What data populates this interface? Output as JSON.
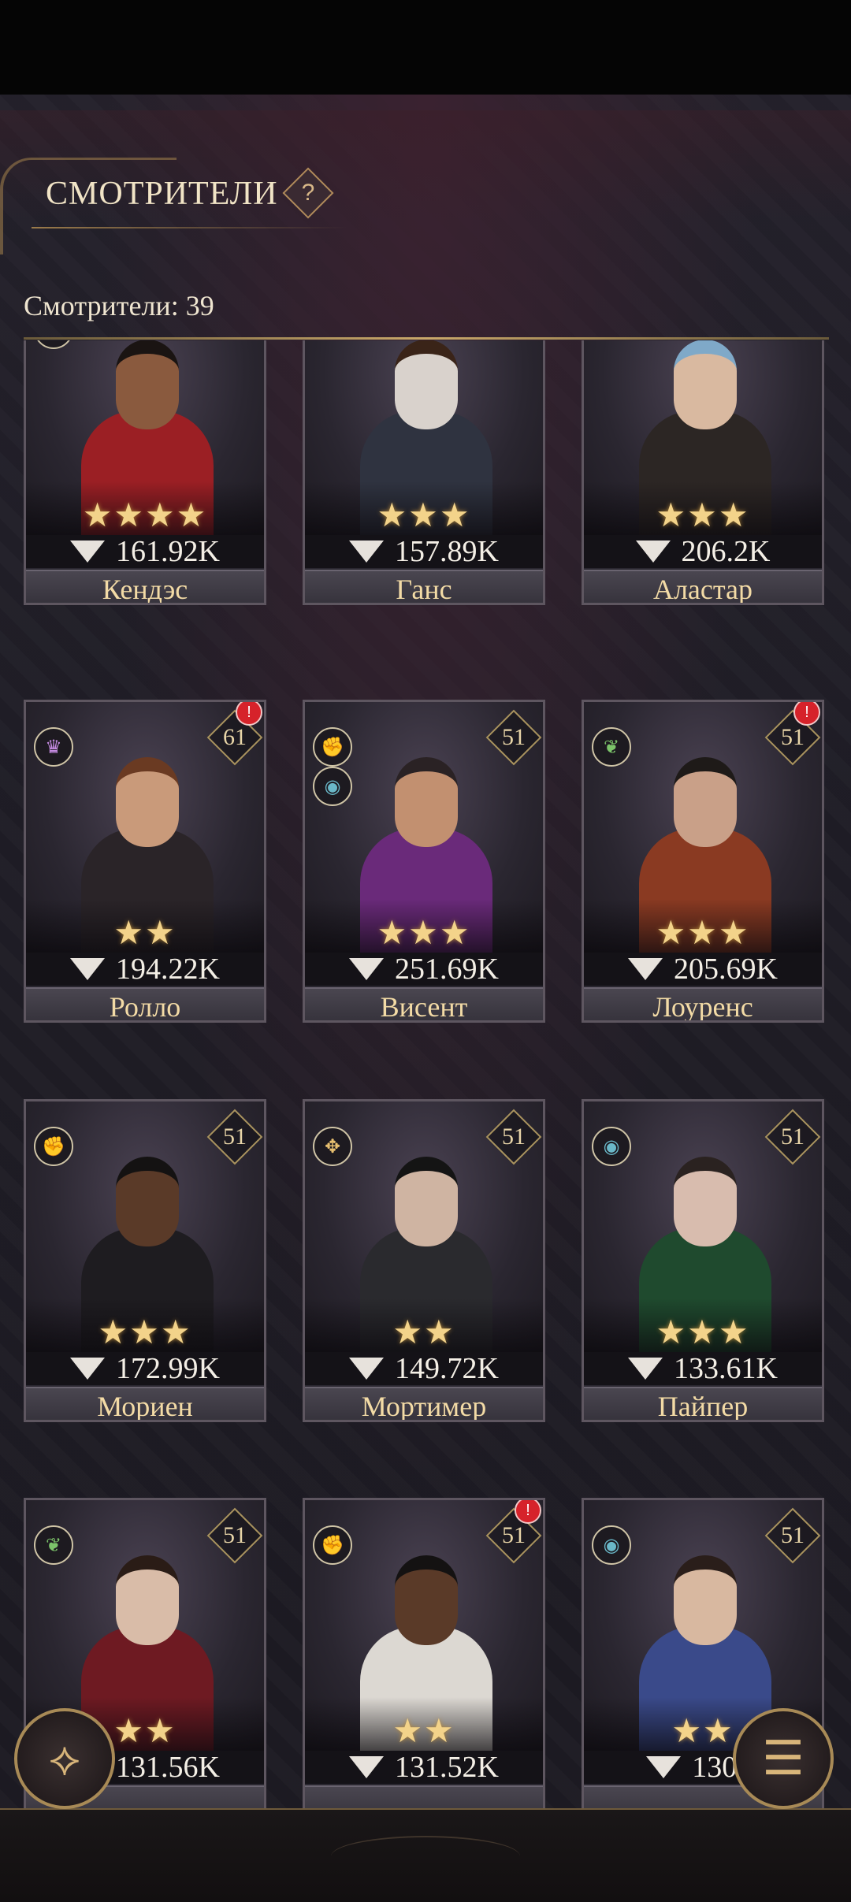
{
  "header": {
    "title": "СМОТРИТЕЛИ",
    "help_label": "?"
  },
  "summary": {
    "count_label": "Смотрители: 39"
  },
  "cards": [
    {
      "name": "Кендэс",
      "power": "161.92K",
      "stars": "★★★★",
      "level": "",
      "role_icon": "leaf-icon",
      "role_glyph": "❦",
      "role_color": "#7cc46a",
      "second_role_icon": "",
      "alert": false,
      "skin": "#8a5a3e",
      "outfit": "#9b1f24",
      "hair": "#1a1412"
    },
    {
      "name": "Ганс",
      "power": "157.89K",
      "stars": "★★★",
      "level": "",
      "role_icon": "",
      "role_glyph": "",
      "role_color": "",
      "second_role_icon": "",
      "alert": false,
      "skin": "#d9d2cc",
      "outfit": "#2f3340",
      "hair": "#3a2418"
    },
    {
      "name": "Аластар",
      "power": "206.2K",
      "stars": "★★★",
      "level": "",
      "role_icon": "",
      "role_glyph": "",
      "role_color": "",
      "second_role_icon": "",
      "alert": false,
      "skin": "#d9b9a0",
      "outfit": "#2c2624",
      "hair": "#7fa9c8"
    },
    {
      "name": "Ролло",
      "power": "194.22K",
      "stars": "★★",
      "level": "61",
      "role_icon": "mask-icon",
      "role_glyph": "♛",
      "role_color": "#c48ae0",
      "second_role_icon": "",
      "alert": true,
      "skin": "#c99a7a",
      "outfit": "#2a2428",
      "hair": "#6a3a22"
    },
    {
      "name": "Висент",
      "power": "251.69K",
      "stars": "★★★",
      "level": "51",
      "role_icon": "fist-icon",
      "role_glyph": "✊",
      "role_color": "#e06a5a",
      "second_role_icon": "eye-icon",
      "alert": false,
      "skin": "#c29070",
      "outfit": "#6a2a7a",
      "hair": "#2a2224"
    },
    {
      "name": "Лоуренс",
      "power": "205.69K",
      "stars": "★★★",
      "level": "51",
      "role_icon": "leaf-icon",
      "role_glyph": "❦",
      "role_color": "#7cc46a",
      "second_role_icon": "",
      "alert": true,
      "skin": "#c9a088",
      "outfit": "#8a3a22",
      "hair": "#1e1a18"
    },
    {
      "name": "Мориен",
      "power": "172.99K",
      "stars": "★★★",
      "level": "51",
      "role_icon": "fist-icon",
      "role_glyph": "✊",
      "role_color": "#e06a5a",
      "second_role_icon": "",
      "alert": false,
      "skin": "#5a3a28",
      "outfit": "#1e1c20",
      "hair": "#141212"
    },
    {
      "name": "Мортимер",
      "power": "149.72K",
      "stars": "★★",
      "level": "51",
      "role_icon": "compass-icon",
      "role_glyph": "✥",
      "role_color": "#e8c070",
      "second_role_icon": "",
      "alert": false,
      "skin": "#cfb4a2",
      "outfit": "#2a2a2e",
      "hair": "#141414"
    },
    {
      "name": "Пайпер",
      "power": "133.61K",
      "stars": "★★★",
      "level": "51",
      "role_icon": "eye-icon",
      "role_glyph": "◉",
      "role_color": "#6ab8c8",
      "second_role_icon": "",
      "alert": false,
      "skin": "#d8bcae",
      "outfit": "#1f4a2e",
      "hair": "#2a2220"
    },
    {
      "name": "",
      "power": "131.56K",
      "stars": "★★",
      "level": "51",
      "role_icon": "leaf-icon",
      "role_glyph": "❦",
      "role_color": "#7cc46a",
      "second_role_icon": "",
      "alert": false,
      "skin": "#d9bca8",
      "outfit": "#6e1a22",
      "hair": "#2a1c16"
    },
    {
      "name": "",
      "power": "131.52K",
      "stars": "★★",
      "level": "51",
      "role_icon": "fist-icon",
      "role_glyph": "✊",
      "role_color": "#e06a5a",
      "second_role_icon": "",
      "alert": true,
      "skin": "#5a3a28",
      "outfit": "#dcd8d2",
      "hair": "#141212"
    },
    {
      "name": "",
      "power": "130.6",
      "stars": "★★",
      "level": "51",
      "role_icon": "eye-icon",
      "role_glyph": "◉",
      "role_color": "#6ab8c8",
      "second_role_icon": "",
      "alert": false,
      "skin": "#d8b8a0",
      "outfit": "#3a4a8a",
      "hair": "#2a1e1a"
    }
  ],
  "fabs": {
    "left_icon": "unicorn-icon",
    "right_icon": "layers-icon"
  },
  "second_role_glyph": "◉",
  "second_role_color": "#6ab8c8"
}
